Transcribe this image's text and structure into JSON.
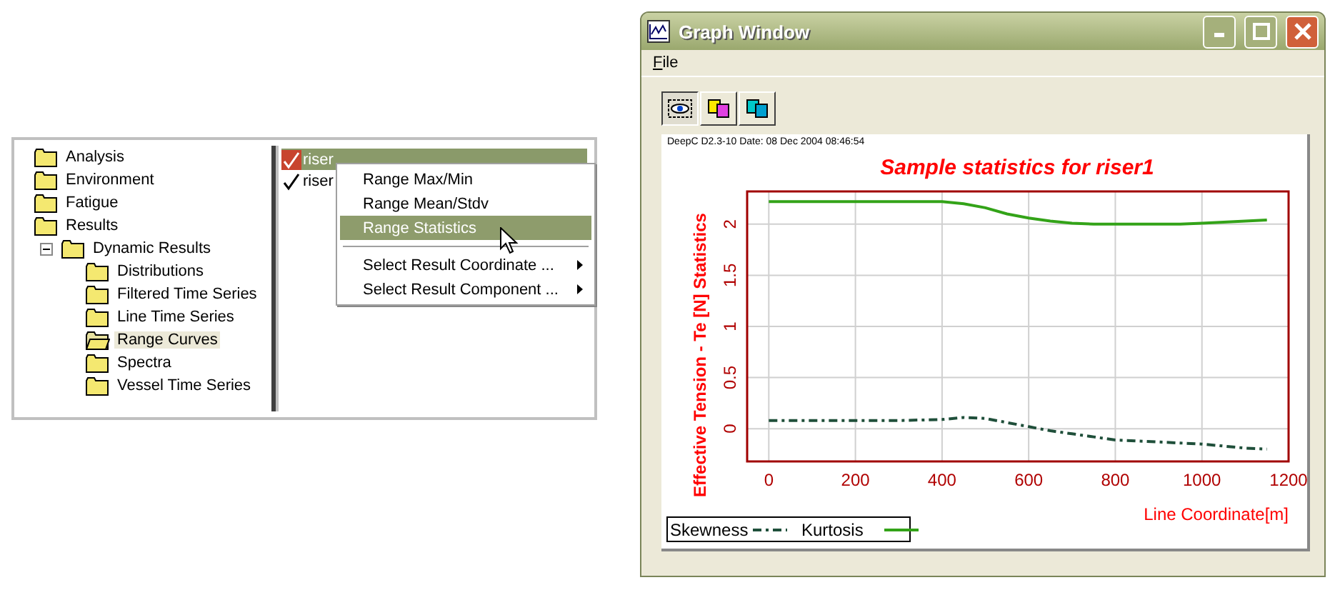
{
  "tree": [
    {
      "label": "Analysis",
      "selected": false
    },
    {
      "label": "Environment",
      "selected": false
    },
    {
      "label": "Fatigue",
      "selected": false
    },
    {
      "label": "Results",
      "selected": false,
      "children": [
        {
          "label": "Dynamic Results",
          "selected": false,
          "expanded": true,
          "children": [
            {
              "label": "Distributions",
              "selected": false
            },
            {
              "label": "Filtered Time Series",
              "selected": false
            },
            {
              "label": "Line Time Series",
              "selected": false
            },
            {
              "label": "Range Curves",
              "selected": true
            },
            {
              "label": "Spectra",
              "selected": false
            },
            {
              "label": "Vessel Time Series",
              "selected": false
            }
          ]
        }
      ]
    }
  ],
  "list_items": [
    {
      "label": "riser",
      "selected": true
    },
    {
      "label": "riser",
      "selected": false
    }
  ],
  "context_menu": [
    {
      "kind": "item",
      "label": "Range Max/Min",
      "selected": false
    },
    {
      "kind": "item",
      "label": "Range Mean/Stdv",
      "selected": false
    },
    {
      "kind": "item",
      "label": "Range Statistics",
      "selected": true
    },
    {
      "kind": "separator"
    },
    {
      "kind": "submenu",
      "label": "Select Result Coordinate ...",
      "selected": false
    },
    {
      "kind": "submenu",
      "label": "Select Result Component ...",
      "selected": false
    }
  ],
  "window": {
    "title": "Graph Window",
    "menu": [
      "File"
    ],
    "toolbar": [
      {
        "pressed": true
      },
      {
        "pressed": false
      },
      {
        "pressed": false
      }
    ]
  },
  "graph": {
    "stamp": "DeepC D2.3-10 Date: 08 Dec 2004 08:46:54",
    "chart_data": {
      "type": "line",
      "title": "Sample statistics for riser1",
      "xlabel": "Line Coordinate[m]",
      "ylabel": "Effective Tension - Te [N] Statistics",
      "xlim": [
        -50,
        1200
      ],
      "ylim": [
        -0.32,
        2.32
      ],
      "xticks": [
        0,
        200,
        400,
        600,
        800,
        1000,
        1200
      ],
      "yticks": [
        0,
        0.5,
        1,
        1.5,
        2
      ],
      "grid": true,
      "legend": true,
      "x": [
        0,
        100,
        200,
        300,
        400,
        450,
        500,
        550,
        600,
        650,
        700,
        750,
        800,
        850,
        900,
        950,
        1000,
        1050,
        1100,
        1150
      ],
      "series": [
        {
          "name": "Skewness",
          "color": "#1f4f3a",
          "line_style": "dashdot",
          "values": [
            0.08,
            0.08,
            0.08,
            0.08,
            0.09,
            0.11,
            0.1,
            0.06,
            0.02,
            -0.02,
            -0.05,
            -0.08,
            -0.11,
            -0.12,
            -0.13,
            -0.14,
            -0.15,
            -0.17,
            -0.19,
            -0.2
          ]
        },
        {
          "name": "Kurtosis",
          "color": "#33a318",
          "line_style": "solid",
          "values": [
            2.22,
            2.22,
            2.22,
            2.22,
            2.22,
            2.2,
            2.16,
            2.1,
            2.06,
            2.03,
            2.01,
            2.0,
            2.0,
            2.0,
            2.0,
            2.0,
            2.01,
            2.02,
            2.03,
            2.04
          ]
        }
      ]
    }
  }
}
